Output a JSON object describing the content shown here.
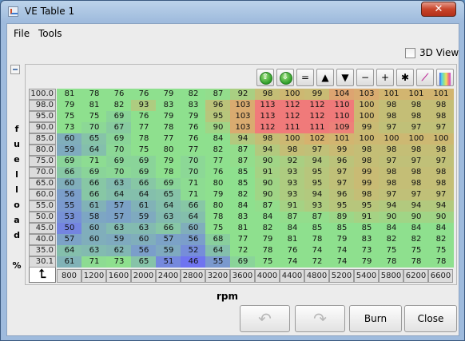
{
  "window": {
    "title": "VE Table 1",
    "close_glyph": "✕"
  },
  "menu": {
    "file": "File",
    "tools": "Tools"
  },
  "view3d": {
    "label": "3D View",
    "checked": false
  },
  "toolbar": {
    "buttons": [
      {
        "name": "increase-icon",
        "glyph": "⇧"
      },
      {
        "name": "decrease-icon",
        "glyph": "⇩"
      },
      {
        "name": "set-equal-icon",
        "glyph": "="
      },
      {
        "name": "up-triangle-icon",
        "glyph": "▲"
      },
      {
        "name": "down-triangle-icon",
        "glyph": "▼"
      },
      {
        "name": "minus-icon",
        "glyph": "−"
      },
      {
        "name": "plus-icon",
        "glyph": "+"
      },
      {
        "name": "multiply-icon",
        "glyph": "✱"
      },
      {
        "name": "interpolate-icon",
        "glyph": "⟋"
      },
      {
        "name": "color-scale-icon",
        "glyph": "▥"
      }
    ]
  },
  "y_axis": {
    "label_chars": [
      "f",
      "u",
      "e",
      "l",
      "l",
      "o",
      "a",
      "d",
      "",
      "%"
    ],
    "label": "fuelload %"
  },
  "x_axis": {
    "label": "rpm"
  },
  "corner_glyph": "⮤",
  "table": {
    "row_labels": [
      "100.0",
      "98.0",
      "95.0",
      "90.0",
      "85.0",
      "80.0",
      "75.0",
      "70.0",
      "65.0",
      "60.0",
      "55.0",
      "50.0",
      "45.0",
      "40.0",
      "35.0",
      "30.1"
    ],
    "col_labels": [
      "800",
      "1200",
      "1600",
      "2000",
      "2400",
      "2800",
      "3200",
      "3600",
      "4000",
      "4400",
      "4800",
      "5200",
      "5400",
      "5800",
      "6200",
      "6600"
    ],
    "rows": [
      [
        "81",
        "78",
        "76",
        "76",
        "79",
        "82",
        "87",
        "92",
        "98",
        "100",
        "99",
        "104",
        "103",
        "101",
        "101",
        "101"
      ],
      [
        "79",
        "81",
        "82",
        "93",
        "83",
        "83",
        "96",
        "103",
        "113",
        "112",
        "112",
        "110",
        "100",
        "98",
        "98",
        "98"
      ],
      [
        "75",
        "75",
        "69",
        "76",
        "79",
        "79",
        "95",
        "103",
        "113",
        "112",
        "112",
        "110",
        "100",
        "98",
        "98",
        "98"
      ],
      [
        "73",
        "70",
        "67",
        "77",
        "78",
        "76",
        "90",
        "103",
        "112",
        "111",
        "111",
        "109",
        "99",
        "97",
        "97",
        "97"
      ],
      [
        "60",
        "65",
        "69",
        "78",
        "77",
        "76",
        "84",
        "94",
        "98",
        "100",
        "102",
        "101",
        "100",
        "100",
        "100",
        "100"
      ],
      [
        "59",
        "64",
        "70",
        "75",
        "80",
        "77",
        "82",
        "87",
        "94",
        "98",
        "97",
        "99",
        "98",
        "98",
        "98",
        "98"
      ],
      [
        "69",
        "71",
        "69",
        "69",
        "79",
        "70",
        "77",
        "87",
        "90",
        "92",
        "94",
        "96",
        "98",
        "97",
        "97",
        "97"
      ],
      [
        "66",
        "69",
        "70",
        "69",
        "78",
        "70",
        "76",
        "85",
        "91",
        "93",
        "95",
        "97",
        "99",
        "98",
        "98",
        "98"
      ],
      [
        "60",
        "66",
        "63",
        "66",
        "69",
        "71",
        "80",
        "85",
        "90",
        "93",
        "95",
        "97",
        "99",
        "98",
        "98",
        "98"
      ],
      [
        "56",
        "66",
        "64",
        "64",
        "65",
        "71",
        "79",
        "82",
        "90",
        "93",
        "94",
        "96",
        "98",
        "97",
        "97",
        "97"
      ],
      [
        "55",
        "61",
        "57",
        "61",
        "64",
        "66",
        "80",
        "84",
        "87",
        "91",
        "93",
        "95",
        "95",
        "94",
        "94",
        "94"
      ],
      [
        "53",
        "58",
        "57",
        "59",
        "63",
        "64",
        "78",
        "83",
        "84",
        "87",
        "87",
        "89",
        "91",
        "90",
        "90",
        "90"
      ],
      [
        "50",
        "60",
        "63",
        "63",
        "66",
        "60",
        "75",
        "81",
        "82",
        "84",
        "85",
        "85",
        "85",
        "84",
        "84",
        "84"
      ],
      [
        "57",
        "60",
        "59",
        "60",
        "57",
        "56",
        "68",
        "77",
        "79",
        "81",
        "78",
        "79",
        "83",
        "82",
        "82",
        "82"
      ],
      [
        "64",
        "63",
        "62",
        "56",
        "59",
        "52",
        "64",
        "72",
        "78",
        "76",
        "74",
        "74",
        "73",
        "75",
        "75",
        "75"
      ],
      [
        "61",
        "71",
        "73",
        "65",
        "51",
        "46",
        "55",
        "69",
        "75",
        "74",
        "72",
        "74",
        "79",
        "78",
        "78",
        "78"
      ]
    ]
  },
  "buttons": {
    "undo_glyph": "↶",
    "redo_glyph": "↷",
    "burn": "Burn",
    "close": "Close"
  },
  "colors": {
    "low": "#6f74f0",
    "mid": "#8ee08e",
    "high": "#f07a7a",
    "row_label_bg": "#dcdcdc"
  }
}
